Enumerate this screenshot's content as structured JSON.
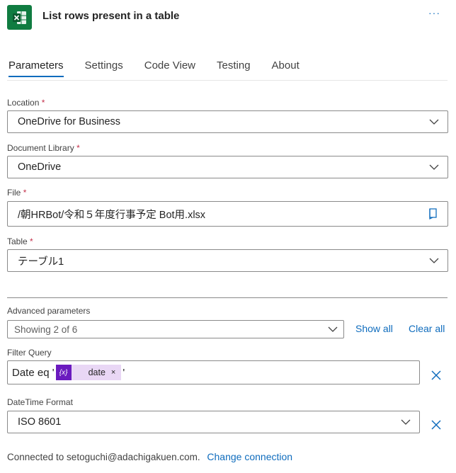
{
  "header": {
    "title": "List rows present in a table",
    "more_label": "···",
    "app_icon": "excel-icon",
    "app_icon_color": "#107c41"
  },
  "tabs": [
    {
      "label": "Parameters",
      "active": true
    },
    {
      "label": "Settings"
    },
    {
      "label": "Code View"
    },
    {
      "label": "Testing"
    },
    {
      "label": "About"
    }
  ],
  "fields": {
    "location": {
      "label": "Location",
      "required": "*",
      "value": "OneDrive for Business"
    },
    "library": {
      "label": "Document Library",
      "required": "*",
      "value": "OneDrive"
    },
    "file": {
      "label": "File",
      "required": "*",
      "value": "/朝HRBot/令和５年度行事予定 Bot用.xlsx"
    },
    "table": {
      "label": "Table",
      "required": "*",
      "value": "テーブル1"
    }
  },
  "advanced": {
    "label": "Advanced parameters",
    "showing": "Showing 2 of 6",
    "show_all": "Show all",
    "clear_all": "Clear all"
  },
  "filter_query": {
    "label": "Filter Query",
    "prefix": "Date eq '",
    "token_label": "date",
    "token_icon_text": "{x}",
    "token_remove": "×",
    "suffix": "'"
  },
  "datetime_format": {
    "label": "DateTime Format",
    "value": "ISO 8601"
  },
  "footer": {
    "connected_text": "Connected to setoguchi@adachigakuen.com.",
    "change_link": "Change connection"
  },
  "colors": {
    "accent": "#0f6cbd",
    "required": "#c4314b",
    "token_bg": "#e9d7f5",
    "token_icon_bg": "#6b1bbf"
  }
}
